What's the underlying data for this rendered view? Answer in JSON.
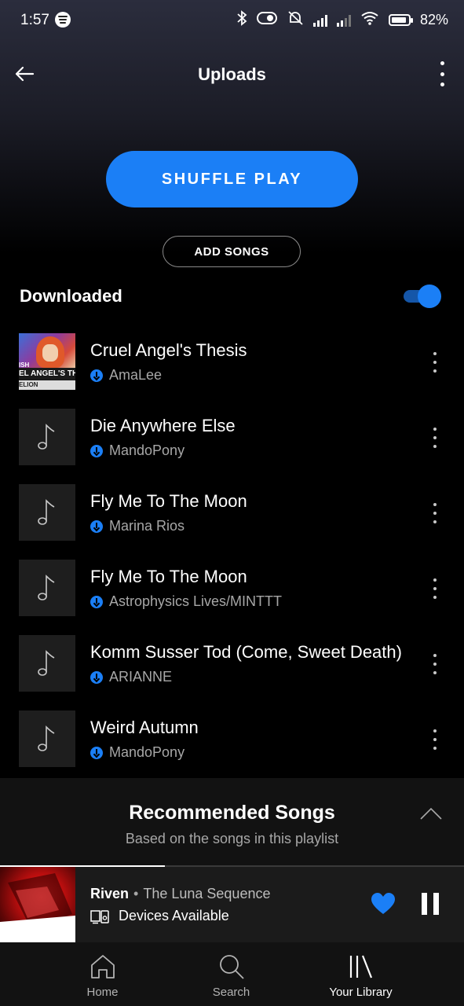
{
  "status_bar": {
    "time": "1:57",
    "battery": "82%"
  },
  "header": {
    "title": "Uploads"
  },
  "actions": {
    "shuffle_label": "SHUFFLE PLAY",
    "add_songs_label": "ADD SONGS"
  },
  "downloaded": {
    "label": "Downloaded",
    "toggle_on": true
  },
  "tracks": [
    {
      "title": "Cruel Angel's Thesis",
      "artist": "AmaLee",
      "art": "album-cover"
    },
    {
      "title": "Die Anywhere Else",
      "artist": "MandoPony",
      "art": "music-note-icon"
    },
    {
      "title": "Fly Me To The Moon",
      "artist": "Marina Rios",
      "art": "music-note-icon"
    },
    {
      "title": "Fly Me To The Moon",
      "artist": "Astrophysics Lives/MINTTT",
      "art": "music-note-icon"
    },
    {
      "title": "Komm Susser Tod (Come, Sweet Death)",
      "artist": "ARIANNE",
      "art": "music-note-icon"
    },
    {
      "title": "Weird Autumn",
      "artist": "MandoPony",
      "art": "music-note-icon"
    }
  ],
  "cover_text": {
    "line1": "ISH",
    "line2": "EL ANGEL'S TH",
    "line3": "ELION"
  },
  "recommended": {
    "title": "Recommended Songs",
    "subtitle": "Based on the songs in this playlist"
  },
  "now_playing": {
    "song": "Riven",
    "separator": "•",
    "artist": "The Luna Sequence",
    "device": "Devices Available",
    "progress": 0.355,
    "liked": true
  },
  "nav": {
    "home": "Home",
    "search": "Search",
    "library": "Your Library",
    "active": "library"
  },
  "colors": {
    "accent": "#1b7ff6",
    "background": "#000000",
    "secondary_text": "#a7a7a7"
  }
}
